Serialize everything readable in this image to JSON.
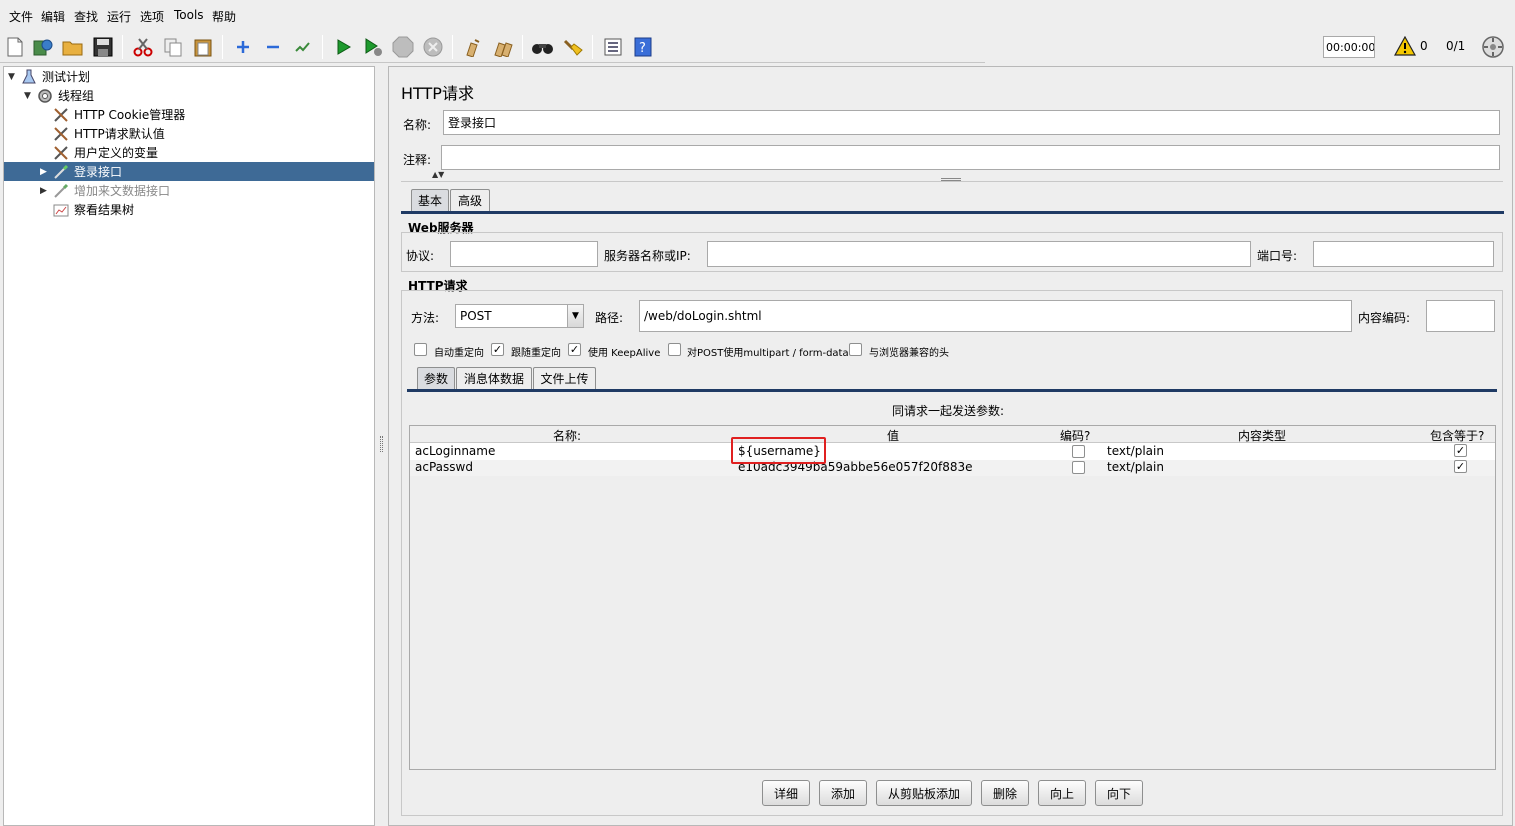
{
  "menu": {
    "items": [
      "文件",
      "编辑",
      "查找",
      "运行",
      "选项",
      "Tools",
      "帮助"
    ]
  },
  "toolbar": {
    "timer": "00:00:00",
    "warning_count": "0",
    "threads": "0/1",
    "icons": [
      "new-icon",
      "templates-icon",
      "open-icon",
      "save-icon",
      "cut-icon",
      "copy-icon",
      "paste-icon",
      "expand-icon",
      "collapse-icon",
      "toggle-icon",
      "start-icon",
      "start-no-pause-icon",
      "stop-icon",
      "shutdown-icon",
      "clear-icon",
      "clear-all-icon",
      "search-icon",
      "reset-search-icon",
      "function-helper-icon",
      "help-icon"
    ]
  },
  "tree": {
    "items": [
      {
        "label": "测试计划",
        "icon": "test-plan-icon"
      },
      {
        "label": "线程组",
        "icon": "thread-group-icon"
      },
      {
        "label": "HTTP Cookie管理器",
        "icon": "config-element-icon"
      },
      {
        "label": "HTTP请求默认值",
        "icon": "config-element-icon"
      },
      {
        "label": "用户定义的变量",
        "icon": "config-element-icon"
      },
      {
        "label": "登录接口",
        "icon": "sampler-icon"
      },
      {
        "label": "增加来文数据接口",
        "icon": "sampler-icon"
      },
      {
        "label": "察看结果树",
        "icon": "listener-icon"
      }
    ]
  },
  "panel": {
    "title": "HTTP请求",
    "name_label": "名称:",
    "name_value": "登录接口",
    "comment_label": "注释:",
    "comment_value": "",
    "tabs": [
      "基本",
      "高级"
    ],
    "web_server": {
      "title": "Web服务器",
      "protocol_label": "协议:",
      "protocol_value": "",
      "server_label": "服务器名称或IP:",
      "server_value": "",
      "port_label": "端口号:",
      "port_value": ""
    },
    "http_request": {
      "title": "HTTP请求",
      "method_label": "方法:",
      "method_value": "POST",
      "path_label": "路径:",
      "path_value": "/web/doLogin.shtml",
      "encoding_label": "内容编码:",
      "encoding_value": ""
    },
    "options": [
      {
        "label": "自动重定向",
        "checked": false
      },
      {
        "label": "跟随重定向",
        "checked": true
      },
      {
        "label": "使用 KeepAlive",
        "checked": true
      },
      {
        "label": "对POST使用multipart / form-data",
        "checked": false
      },
      {
        "label": "与浏览器兼容的头",
        "checked": false
      }
    ],
    "sub_tabs": [
      "参数",
      "消息体数据",
      "文件上传"
    ],
    "params_caption": "同请求一起发送参数:",
    "table": {
      "headers": [
        "名称:",
        "值",
        "编码?",
        "内容类型",
        "包含等于?"
      ],
      "rows": [
        {
          "name": "acLoginname",
          "value": "${username}",
          "encode": false,
          "content_type": "text/plain",
          "include_equals": true
        },
        {
          "name": "acPasswd",
          "value": "e10adc3949ba59abbe56e057f20f883e",
          "encode": false,
          "content_type": "text/plain",
          "include_equals": true
        }
      ]
    },
    "buttons": [
      "详细",
      "添加",
      "从剪贴板添加",
      "删除",
      "向上",
      "向下"
    ]
  },
  "colors": {
    "selection": "#3e6a96",
    "highlight_border": "#e02020"
  }
}
